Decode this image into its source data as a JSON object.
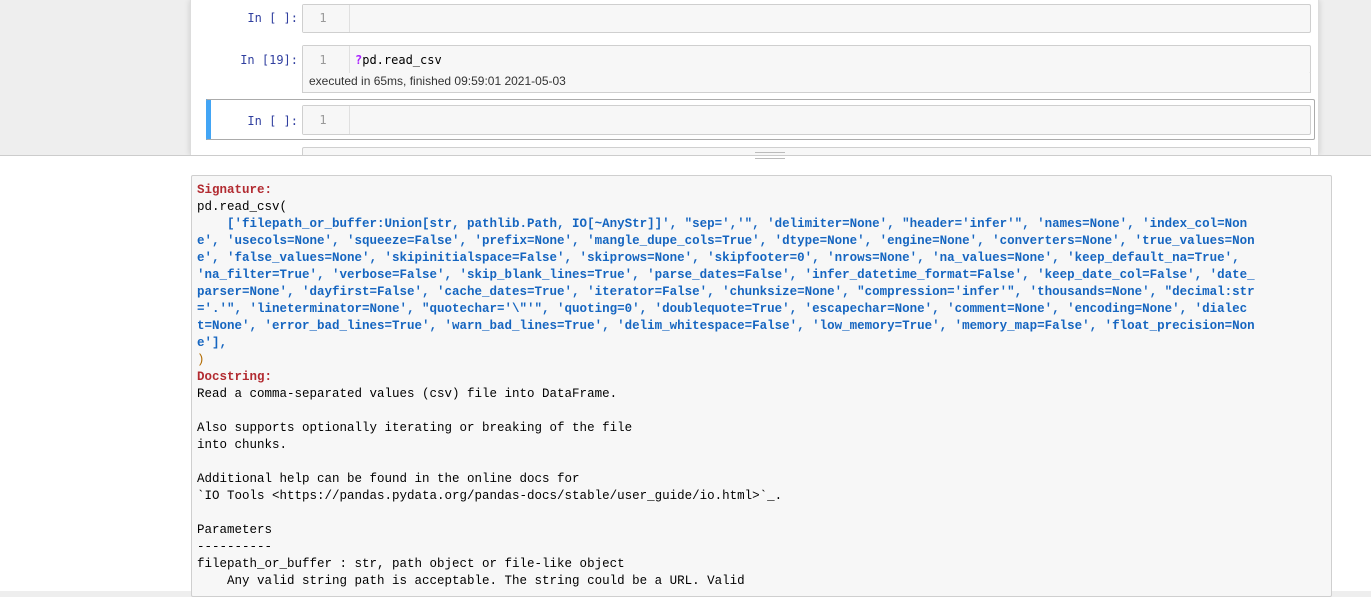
{
  "cells": [
    {
      "prompt": "In [ ]:",
      "line": "1",
      "code": ""
    },
    {
      "prompt": "In [19]:",
      "line": "1",
      "code_prefix": "?",
      "code": "pd.read_csv",
      "exec_info": "executed in 65ms, finished 09:59:01 2021-05-03"
    },
    {
      "prompt": "In [ ]:",
      "line": "1",
      "code": ""
    }
  ],
  "pager": {
    "signature_header": "Signature:",
    "signature_call": "pd.read_csv(",
    "signature_args": "    ['filepath_or_buffer:Union[str, pathlib.Path, IO[~AnyStr]]', \"sep=','\", 'delimiter=None', \"header='infer'\", 'names=None', 'index_col=Non\ne', 'usecols=None', 'squeeze=False', 'prefix=None', 'mangle_dupe_cols=True', 'dtype=None', 'engine=None', 'converters=None', 'true_values=Non\ne', 'false_values=None', 'skipinitialspace=False', 'skiprows=None', 'skipfooter=0', 'nrows=None', 'na_values=None', 'keep_default_na=True',\n'na_filter=True', 'verbose=False', 'skip_blank_lines=True', 'parse_dates=False', 'infer_datetime_format=False', 'keep_date_col=False', 'date_\nparser=None', 'dayfirst=False', 'cache_dates=True', 'iterator=False', 'chunksize=None', \"compression='infer'\", 'thousands=None', \"decimal:str\n='.'\", 'lineterminator=None', \"quotechar='\\\"'\", 'quoting=0', 'doublequote=True', 'escapechar=None', 'comment=None', 'encoding=None', 'dialec\nt=None', 'error_bad_lines=True', 'warn_bad_lines=True', 'delim_whitespace=False', 'low_memory=True', 'memory_map=False', 'float_precision=Non\ne'],",
    "signature_close": ")",
    "docstring_header": "Docstring:",
    "docstring_body": "Read a comma-separated values (csv) file into DataFrame.\n\nAlso supports optionally iterating or breaking of the file\ninto chunks.\n\nAdditional help can be found in the online docs for\n`IO Tools <https://pandas.pydata.org/pandas-docs/stable/user_guide/io.html>`_.\n\nParameters\n----------\nfilepath_or_buffer : str, path object or file-like object\n    Any valid string path is acceptable. The string could be a URL. Valid"
  },
  "colors": {
    "prompt": "#303f9f",
    "selected_accent": "#42a5f5",
    "header_red": "#b22b31",
    "signature_blue": "#1565c0"
  }
}
